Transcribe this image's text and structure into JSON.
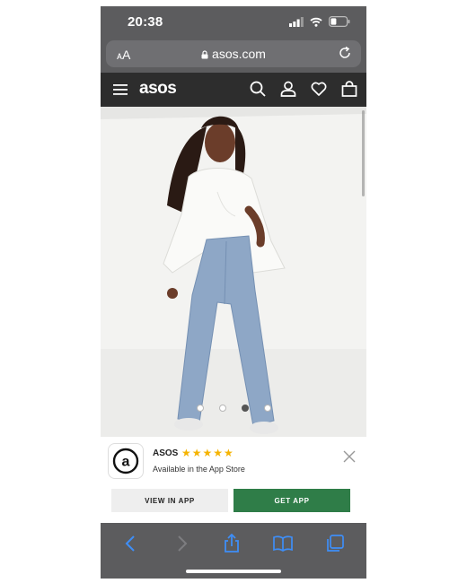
{
  "status_bar": {
    "time": "20:38"
  },
  "browser": {
    "text_size_label": "AA",
    "url": "asos.com"
  },
  "site_header": {
    "logo": "asos"
  },
  "product": {
    "image_count": 4,
    "active_image_index": 2
  },
  "app_banner": {
    "app_name": "ASOS",
    "rating_stars": "★★★★★",
    "rating": 5,
    "subtitle": "Available in the App Store",
    "icon_letter": "a",
    "view_label": "VIEW IN APP",
    "get_label": "GET APP"
  },
  "colors": {
    "chrome": "#5c5c5e",
    "header": "#2d2d2d",
    "get_app": "#2f7d48",
    "stars": "#f5b301"
  }
}
